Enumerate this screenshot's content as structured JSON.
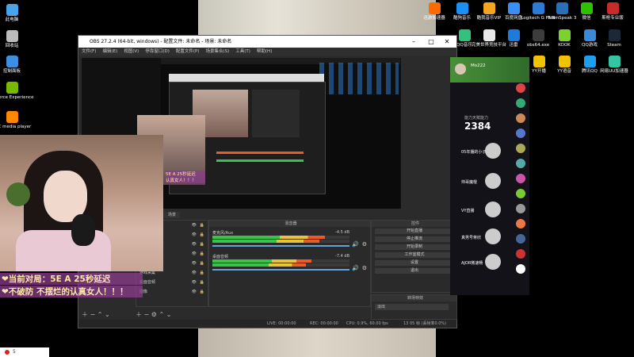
{
  "desktop_left": [
    {
      "label": "此电脑",
      "color": "#4aa3e8"
    },
    {
      "label": "回收站",
      "color": "#bbbbbb"
    },
    {
      "label": "控制面板",
      "color": "#3f8fe0"
    },
    {
      "label": "GeForce Experience",
      "color": "#76b900"
    },
    {
      "label": "VLC media player",
      "color": "#ff8800"
    }
  ],
  "desktop_top": [
    {
      "label": "迅游加速器",
      "color": "#ff6a00"
    },
    {
      "label": "酷狗音乐",
      "color": "#1d8ff2"
    },
    {
      "label": "酷我音乐VIP",
      "color": "#f2a51d"
    },
    {
      "label": "百度网盘",
      "color": "#3a8ff5"
    },
    {
      "label": "Logitech G HUB",
      "color": "#2d7bd4"
    },
    {
      "label": "TeamSpeak 3",
      "color": "#2a6fb5"
    },
    {
      "label": "微信",
      "color": "#2dc100"
    },
    {
      "label": "斯枪专业版",
      "color": "#c92b2b"
    }
  ],
  "desktop_top2": [
    {
      "label": "QQ音乐",
      "color": "#31c27c"
    },
    {
      "label": "完美世界竞技平台",
      "color": "#e8e8e8"
    },
    {
      "label": "迅雷",
      "color": "#1e7bdc"
    },
    {
      "label": "obs64.exe",
      "color": "#3c3c3c"
    },
    {
      "label": "KOOK",
      "color": "#7ad32c"
    },
    {
      "label": "QQ游戏",
      "color": "#3b89d9"
    },
    {
      "label": "Steam",
      "color": "#1b2838"
    }
  ],
  "desktop_top3": [
    {
      "label": "YY开播",
      "color": "#f2c200"
    },
    {
      "label": "YY语音",
      "color": "#f2c200"
    },
    {
      "label": "腾讯QQ",
      "color": "#1ea0f0"
    },
    {
      "label": "网易UU加速器",
      "color": "#33c6a0"
    }
  ],
  "obs": {
    "title": "OBS 27.2.4 (64-bit, windows) - 配置文件: 未命名 - 场景: 未命名",
    "menus": [
      "文件(F)",
      "编辑(E)",
      "视图(V)",
      "停靠窗口(D)",
      "配置文件(P)",
      "场景集合(S)",
      "工具(T)",
      "帮助(H)"
    ],
    "stream_lines": [
      "5E A 25秒延迟",
      "认真女人！！！"
    ],
    "mixer_title": "混音器",
    "mixer_tracks": [
      {
        "name": "麦克风/Aux",
        "db": "-4.5 dB",
        "level": 0.82
      },
      {
        "name": "桌面音频",
        "db": "-7.4 dB",
        "level": 0.72
      }
    ],
    "controls_title": "控件",
    "controls_buttons": [
      "开始直播",
      "停止推流",
      "开始录制",
      "工作室模式",
      "设置",
      "退出"
    ],
    "transitions_title": "转场特效",
    "transition_value": "淡出",
    "sources": [
      "场景 3",
      "场景来源",
      "场景",
      "麦克风/Aux",
      "视频采集设备",
      "游戏采集",
      "桌面音频",
      "图像"
    ],
    "status": {
      "live_label": "LIVE:",
      "live_time": "00:00:00",
      "rec_label": "REC:",
      "rec_time": "00:00:00",
      "cpu": "CPU: 0.9%, 60.00 fps",
      "other": "13 05 帧 (丢帧率0.0%)"
    },
    "source_tab": "场景"
  },
  "overlay": {
    "line1": "❤当前对局：5E A 25秒延迟",
    "line2": "❤不破防 不摆烂的认真女人！！！"
  },
  "chat": {
    "viewer_count": "2384",
    "viewer_label": "能力天赋能力",
    "users": [
      {
        "name": "05年播的小子"
      },
      {
        "name": "帅哥魔棍"
      },
      {
        "name": "VY直播"
      },
      {
        "name": "真男号蒋欣"
      },
      {
        "name": "AJOR微速畅"
      }
    ],
    "header_name": "Mo222"
  },
  "taskbar_item": "5"
}
